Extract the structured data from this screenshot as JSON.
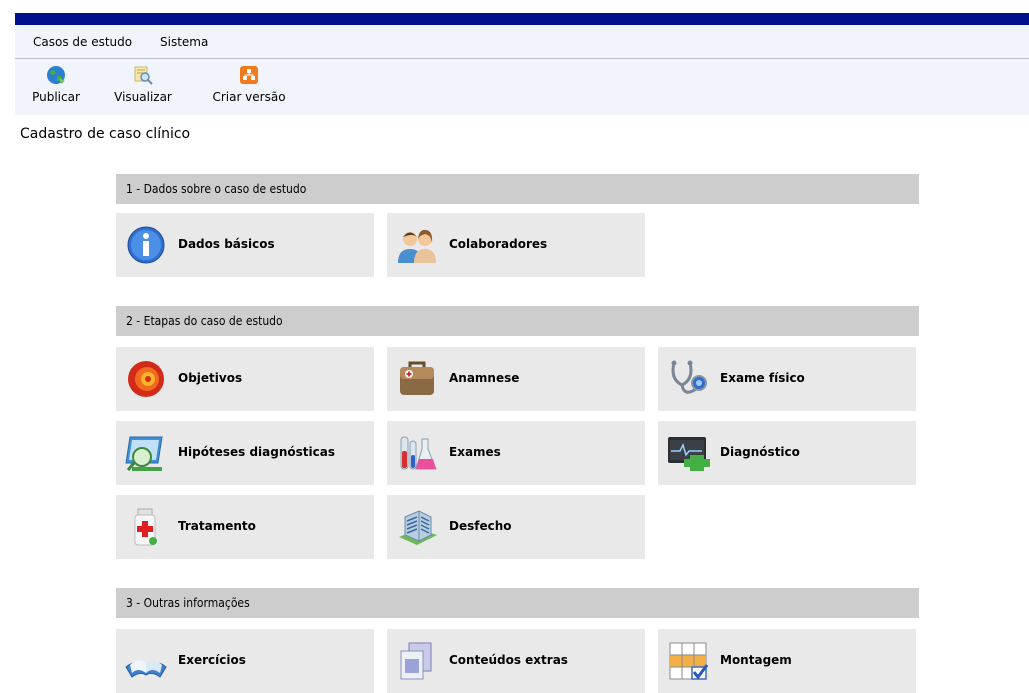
{
  "menu": {
    "items": [
      {
        "label": "Casos de estudo"
      },
      {
        "label": "Sistema"
      }
    ]
  },
  "toolbar": {
    "items": [
      {
        "label": "Publicar",
        "icon": "globe-icon"
      },
      {
        "label": "Visualizar",
        "icon": "magnifier-icon"
      },
      {
        "label": "Criar versão",
        "icon": "hierarchy-icon"
      }
    ]
  },
  "page": {
    "title": "Cadastro de caso clínico"
  },
  "sections": [
    {
      "title": "1 - Dados sobre o caso de estudo",
      "tiles": [
        {
          "label": "Dados básicos",
          "icon": "info-icon"
        },
        {
          "label": "Colaboradores",
          "icon": "users-icon"
        }
      ]
    },
    {
      "title": "2 - Etapas do caso de estudo",
      "tiles": [
        {
          "label": "Objetivos",
          "icon": "target-icon"
        },
        {
          "label": "Anamnese",
          "icon": "medical-bag-icon"
        },
        {
          "label": "Exame físico",
          "icon": "stethoscope-icon"
        },
        {
          "label": "Hipóteses diagnósticas",
          "icon": "analysis-icon"
        },
        {
          "label": "Exames",
          "icon": "flasks-icon"
        },
        {
          "label": "Diagnóstico",
          "icon": "monitor-plus-icon"
        },
        {
          "label": "Tratamento",
          "icon": "medicine-bottle-icon"
        },
        {
          "label": "Desfecho",
          "icon": "hospital-icon"
        }
      ]
    },
    {
      "title": "3 - Outras informações",
      "tiles": [
        {
          "label": "Exercícios",
          "icon": "book-icon"
        },
        {
          "label": "Conteúdos extras",
          "icon": "documents-icon"
        },
        {
          "label": "Montagem",
          "icon": "grid-check-icon"
        }
      ]
    }
  ],
  "colors": {
    "title_bar": "#000f8c",
    "menu_bg": "#f2f4fb",
    "section_header_bg": "#cdcdcd",
    "tile_bg": "#e9e9e9"
  }
}
